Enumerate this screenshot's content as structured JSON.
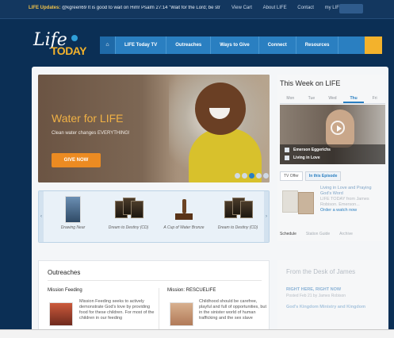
{
  "topbar": {
    "updates_label": "LIFE Updates:",
    "ticker": "@kgreen69 It is good to wait on Him! Psalm 27:14 \"Wait for the Lord; be strong ...",
    "links": [
      "View Cart",
      "About LIFE",
      "Contact",
      "my LIFE"
    ]
  },
  "logo": {
    "life": "Life",
    "today": "TODAY"
  },
  "nav": {
    "home": "⌂",
    "items": [
      "LIFE Today TV",
      "Outreaches",
      "Ways to Give",
      "Connect",
      "Resources"
    ]
  },
  "hero": {
    "title": "Water for LIFE",
    "subtitle": "Clean water changes EVERYTHING!",
    "button": "GIVE NOW",
    "slides": 5,
    "active_slide": 3
  },
  "products": [
    {
      "caption": "Drawing Near"
    },
    {
      "caption": "Dream to Destiny (CD)"
    },
    {
      "caption": "A Cup of Water Bronze"
    },
    {
      "caption": "Dream to Destiny (CD)"
    }
  ],
  "week": {
    "title": "This Week on LIFE",
    "days": [
      "Mon",
      "Tue",
      "Wed",
      "Thu",
      "Fri"
    ],
    "active_day": "Thu",
    "guest": "Emerson Eggerichs",
    "episode": "Living in Love",
    "tabs": [
      "TV Offer",
      "In this Episode"
    ],
    "offer_title": "Living in Love and Praying God's Word",
    "offer_lines": [
      "LIFE TODAY from James",
      "Robison. Emerson...",
      "Order a watch now."
    ],
    "offer_link": "Order a watch now",
    "links": [
      "Schedule",
      "Station Guide",
      "Archive"
    ]
  },
  "outreach": {
    "title": "Outreaches",
    "col1_title": "Mission Feeding",
    "col1_text": "Mission Feeding seeks to actively demonstrate God's love by providing food for these children. For most of the children in our feeding",
    "col2_title": "Mission: RESCUELIFE",
    "col2_text": "Childhood should be carefree, playful and full of opportunities, but in the sinister world of human trafficking and the sex slave"
  },
  "desk": {
    "title": "From the Desk of James",
    "item1": "RIGHT HERE, RIGHT NOW",
    "item1_meta": "Posted Feb 21 by James Robison",
    "item2": "God's Kingdom Ministry and Kingdom"
  }
}
